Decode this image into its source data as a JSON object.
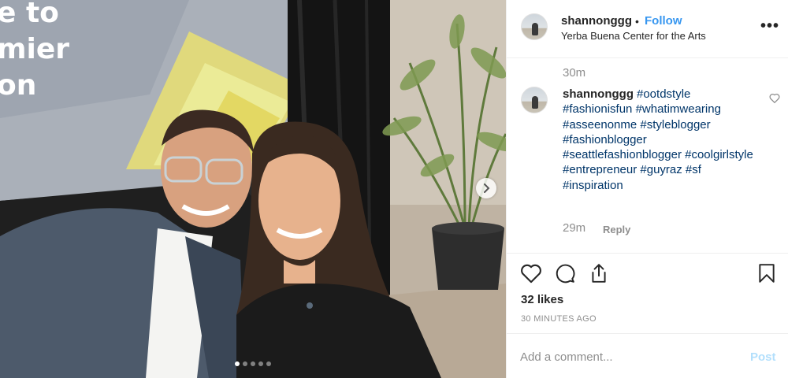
{
  "post": {
    "username": "shannonggg",
    "separator": "•",
    "follow_label": "Follow",
    "location": "Yerba Buena Center for the Arts",
    "more_label": "•••"
  },
  "photo": {
    "screen_text": [
      "e to",
      "mier",
      "on"
    ],
    "carousel": {
      "total": 5,
      "active": 1
    },
    "next_icon": "chevron-right-icon"
  },
  "previous_comment_time": "30m",
  "caption": {
    "username": "shannonggg",
    "hashtags": "#ootdstyle #fashionisfun #whatimwearing #asseenonme #styleblogger #fashionblogger #seattlefashionblogger #coolgirlstyle #entrepreneur #guyraz #sf #inspiration",
    "time": "29m",
    "reply_label": "Reply",
    "like_icon": "heart-outline-icon"
  },
  "actions": {
    "icons": [
      "heart-icon",
      "comment-icon",
      "share-icon",
      "bookmark-icon"
    ],
    "likes": "32 likes",
    "timestamp": "30 MINUTES AGO"
  },
  "add_comment": {
    "placeholder": "Add a comment...",
    "post_label": "Post"
  },
  "colors": {
    "link_blue": "#3897f0",
    "hashtag_blue": "#003569",
    "post_disabled": "#b2dffc",
    "muted_gray": "#8e8e8e"
  }
}
